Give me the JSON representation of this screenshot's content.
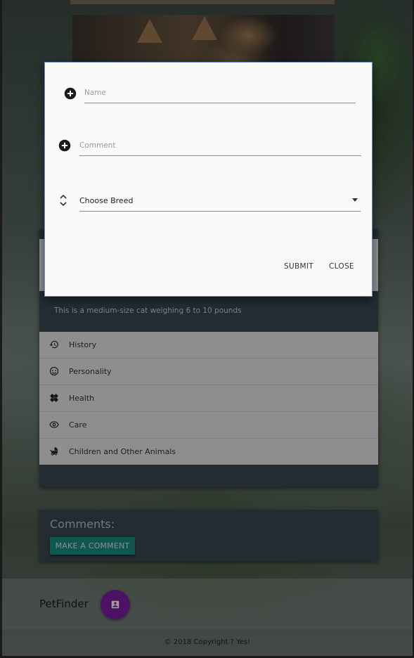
{
  "modal": {
    "name_placeholder": "Name",
    "comment_placeholder": "Comment",
    "breed_select_value": "Choose Breed",
    "submit_label": "SUBMIT",
    "close_label": "CLOSE"
  },
  "card": {
    "description": "This is a medium-size cat weighing 6 to 10 pounds",
    "items": [
      {
        "label": "History",
        "icon": "history-icon"
      },
      {
        "label": "Personality",
        "icon": "smiley-icon"
      },
      {
        "label": "Health",
        "icon": "healing-icon"
      },
      {
        "label": "Care",
        "icon": "eye-icon"
      },
      {
        "label": "Children and Other Animals",
        "icon": "stroller-icon"
      }
    ]
  },
  "comments": {
    "title": "Comments:",
    "button_label": "MAKE A COMMENT"
  },
  "footer": {
    "brand": "PetFinder",
    "copyright": "© 2018 Copyright ? Yes!"
  },
  "colors": {
    "accent_teal": "#1e8c82",
    "fab_purple": "#7b1fa2",
    "card_dark": "#37474f",
    "modal_border": "#6a8fd6"
  }
}
